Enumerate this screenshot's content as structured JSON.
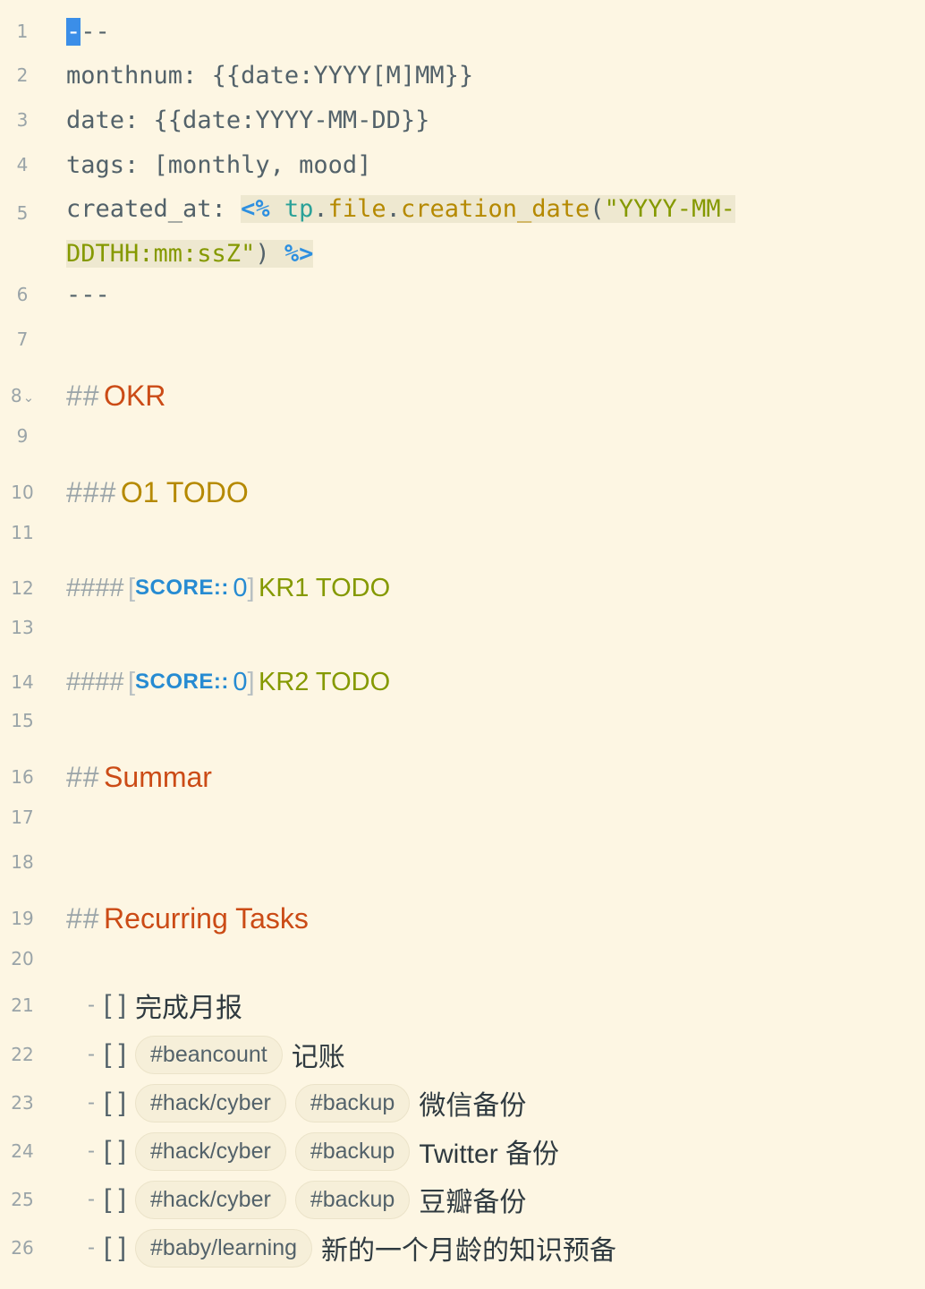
{
  "frontmatter": {
    "delim": "---",
    "monthnum_key": "monthnum:",
    "monthnum_val": "{{date:YYYY[M]MM}}",
    "date_key": "date:",
    "date_val": "{{date:YYYY-MM-DD}}",
    "tags_key": "tags:",
    "tags_val": "[monthly, mood]",
    "created_key": "created_at:",
    "tpl_open": "<%",
    "tpl_obj": "tp",
    "tpl_dot": ".",
    "tpl_file": "file",
    "tpl_fn": "creation_date",
    "tpl_paren_open": "(",
    "tpl_str1": "\"YYYY-MM-",
    "tpl_str2": "DDTHH:mm:ssZ\"",
    "tpl_paren_close": ")",
    "tpl_close": "%>"
  },
  "line_numbers": [
    "1",
    "2",
    "3",
    "4",
    "5",
    "6",
    "7",
    "8",
    "9",
    "10",
    "11",
    "12",
    "13",
    "14",
    "15",
    "16",
    "17",
    "18",
    "19",
    "20",
    "21",
    "22",
    "23",
    "24",
    "25",
    "26"
  ],
  "fold_icon": "chevron-down-icon",
  "headings": {
    "h2_mark": "##",
    "h3_mark": "###",
    "h4_mark": "####",
    "okr": "OKR",
    "o1": "O1 TODO",
    "kr1": "KR1 TODO",
    "kr2": "KR2 TODO",
    "summar": "Summar",
    "recurring": "Recurring Tasks"
  },
  "score_field": {
    "open": "[",
    "key": "SCORE::",
    "value": "0",
    "close": "]"
  },
  "tasks": {
    "dash": "-",
    "checkbox": "[ ]",
    "t21_text": "完成月报",
    "t22_tag": "#beancount",
    "t22_text": "记账",
    "tag_hack": "#hack/cyber",
    "tag_backup": "#backup",
    "t23_text": "微信备份",
    "t24_text": "Twitter 备份",
    "t25_text": "豆瓣备份",
    "t26_tag": "#baby/learning",
    "t26_text": "新的一个月龄的知识预备"
  }
}
